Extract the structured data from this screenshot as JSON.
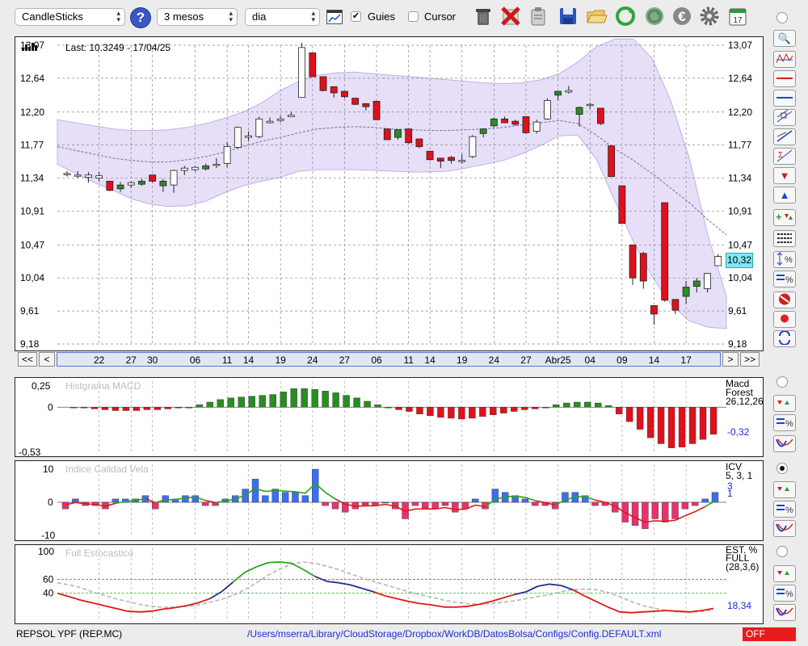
{
  "toolbar": {
    "chart_type": "CandleSticks",
    "period": "3 mesos",
    "interval": "dia",
    "guides_label": "Guies",
    "guides_checked": true,
    "cursor_label": "Cursor",
    "cursor_checked": false,
    "icons": [
      "trash-icon",
      "delete-icon",
      "clipboard-icon",
      "save-icon",
      "open-folder-icon",
      "refresh-icon",
      "reload-icon",
      "euro-icon",
      "gear-icon",
      "calendar-icon"
    ],
    "calendar_day": "17"
  },
  "status": {
    "ticker": "REPSOL YPF (REP.MC)",
    "path": "/Users/mserra/Library/CloudStorage/Dropbox/WorkDB/DatosBolsa/Configs/Config.DEFAULT.xml",
    "state": "OFF"
  },
  "nav": {
    "first": "<<",
    "prev": "<",
    "next": ">",
    "last": ">>"
  },
  "chart_data": [
    {
      "type": "candlestick",
      "title": "Last: 10.3249 - 17/04/25",
      "yticks": [
        "13,07",
        "12,64",
        "12,20",
        "11,77",
        "11,34",
        "10,91",
        "10,47",
        "10,04",
        "9,61",
        "9,18"
      ],
      "ylim": [
        9.18,
        13.07
      ],
      "last_value": "10,32",
      "date_labels": [
        "22",
        "27",
        "30",
        "06",
        "11",
        "14",
        "19",
        "24",
        "27",
        "06",
        "11",
        "14",
        "19",
        "24",
        "27",
        "Abr25",
        "04",
        "09",
        "14",
        "17"
      ],
      "candles": [
        {
          "o": 11.4,
          "h": 11.43,
          "l": 11.36,
          "c": 11.4
        },
        {
          "o": 11.38,
          "h": 11.43,
          "l": 11.34,
          "c": 11.38
        },
        {
          "o": 11.35,
          "h": 11.42,
          "l": 11.28,
          "c": 11.38
        },
        {
          "o": 11.34,
          "h": 11.42,
          "l": 11.3,
          "c": 11.37
        },
        {
          "o": 11.3,
          "h": 11.3,
          "l": 11.17,
          "c": 11.18
        },
        {
          "o": 11.2,
          "h": 11.29,
          "l": 11.16,
          "c": 11.25
        },
        {
          "o": 11.25,
          "h": 11.3,
          "l": 11.21,
          "c": 11.28
        },
        {
          "o": 11.26,
          "h": 11.33,
          "l": 11.24,
          "c": 11.3
        },
        {
          "o": 11.38,
          "h": 11.38,
          "l": 11.28,
          "c": 11.3
        },
        {
          "o": 11.24,
          "h": 11.33,
          "l": 11.16,
          "c": 11.3
        },
        {
          "o": 11.25,
          "h": 11.45,
          "l": 11.15,
          "c": 11.44
        },
        {
          "o": 11.44,
          "h": 11.5,
          "l": 11.38,
          "c": 11.47
        },
        {
          "o": 11.45,
          "h": 11.5,
          "l": 11.43,
          "c": 11.48
        },
        {
          "o": 11.46,
          "h": 11.53,
          "l": 11.44,
          "c": 11.5
        },
        {
          "o": 11.52,
          "h": 11.6,
          "l": 11.47,
          "c": 11.52
        },
        {
          "o": 11.53,
          "h": 11.81,
          "l": 11.48,
          "c": 11.75
        },
        {
          "o": 11.74,
          "h": 12.01,
          "l": 11.72,
          "c": 12.0
        },
        {
          "o": 11.87,
          "h": 11.95,
          "l": 11.82,
          "c": 11.89
        },
        {
          "o": 11.88,
          "h": 12.14,
          "l": 11.86,
          "c": 12.11
        },
        {
          "o": 12.06,
          "h": 12.13,
          "l": 12.05,
          "c": 12.08
        },
        {
          "o": 12.09,
          "h": 12.15,
          "l": 12.07,
          "c": 12.11
        },
        {
          "o": 12.14,
          "h": 12.2,
          "l": 12.14,
          "c": 12.16
        },
        {
          "o": 12.39,
          "h": 13.1,
          "l": 12.39,
          "c": 13.04
        },
        {
          "o": 12.97,
          "h": 12.97,
          "l": 12.66,
          "c": 12.66
        },
        {
          "o": 12.66,
          "h": 12.66,
          "l": 12.47,
          "c": 12.48
        },
        {
          "o": 12.53,
          "h": 12.53,
          "l": 12.39,
          "c": 12.45
        },
        {
          "o": 12.47,
          "h": 12.47,
          "l": 12.38,
          "c": 12.4
        },
        {
          "o": 12.38,
          "h": 12.38,
          "l": 12.29,
          "c": 12.3
        },
        {
          "o": 12.31,
          "h": 12.31,
          "l": 12.22,
          "c": 12.27
        },
        {
          "o": 12.34,
          "h": 12.34,
          "l": 12.1,
          "c": 12.1
        },
        {
          "o": 11.98,
          "h": 11.98,
          "l": 11.84,
          "c": 11.84
        },
        {
          "o": 11.87,
          "h": 11.97,
          "l": 11.84,
          "c": 11.97
        },
        {
          "o": 11.98,
          "h": 11.98,
          "l": 11.79,
          "c": 11.8
        },
        {
          "o": 11.85,
          "h": 11.85,
          "l": 11.73,
          "c": 11.75
        },
        {
          "o": 11.69,
          "h": 11.69,
          "l": 11.57,
          "c": 11.58
        },
        {
          "o": 11.6,
          "h": 11.6,
          "l": 11.47,
          "c": 11.56
        },
        {
          "o": 11.61,
          "h": 11.63,
          "l": 11.53,
          "c": 11.57
        },
        {
          "o": 11.57,
          "h": 11.65,
          "l": 11.53,
          "c": 11.57
        },
        {
          "o": 11.62,
          "h": 11.9,
          "l": 11.6,
          "c": 11.88
        },
        {
          "o": 11.92,
          "h": 11.99,
          "l": 11.87,
          "c": 11.98
        },
        {
          "o": 12.02,
          "h": 12.13,
          "l": 12.0,
          "c": 12.11
        },
        {
          "o": 12.11,
          "h": 12.14,
          "l": 12.06,
          "c": 12.06
        },
        {
          "o": 12.08,
          "h": 12.1,
          "l": 12.02,
          "c": 12.04
        },
        {
          "o": 12.14,
          "h": 12.14,
          "l": 11.92,
          "c": 11.93
        },
        {
          "o": 11.95,
          "h": 12.1,
          "l": 11.92,
          "c": 12.07
        },
        {
          "o": 12.11,
          "h": 12.38,
          "l": 12.1,
          "c": 12.35
        },
        {
          "o": 12.42,
          "h": 12.47,
          "l": 12.35,
          "c": 12.47
        },
        {
          "o": 12.46,
          "h": 12.54,
          "l": 12.44,
          "c": 12.48
        },
        {
          "o": 12.17,
          "h": 12.27,
          "l": 12.01,
          "c": 12.26
        },
        {
          "o": 12.3,
          "h": 12.32,
          "l": 12.24,
          "c": 12.3
        },
        {
          "o": 12.25,
          "h": 12.25,
          "l": 12.03,
          "c": 12.05
        },
        {
          "o": 11.76,
          "h": 11.76,
          "l": 11.36,
          "c": 11.36
        },
        {
          "o": 11.24,
          "h": 11.24,
          "l": 10.75,
          "c": 10.75
        },
        {
          "o": 10.47,
          "h": 10.47,
          "l": 9.95,
          "c": 10.04
        },
        {
          "o": 10.36,
          "h": 10.38,
          "l": 9.9,
          "c": 10.0
        },
        {
          "o": 9.68,
          "h": 9.68,
          "l": 9.43,
          "c": 9.57
        },
        {
          "o": 11.02,
          "h": 11.02,
          "l": 9.73,
          "c": 9.75
        },
        {
          "o": 9.76,
          "h": 9.76,
          "l": 9.57,
          "c": 9.62
        },
        {
          "o": 9.8,
          "h": 10.0,
          "l": 9.7,
          "c": 9.92
        },
        {
          "o": 9.93,
          "h": 10.04,
          "l": 9.85,
          "c": 10.0
        },
        {
          "o": 9.9,
          "h": 10.1,
          "l": 9.85,
          "c": 10.1
        },
        {
          "o": 10.2,
          "h": 10.35,
          "l": 10.2,
          "c": 10.32
        }
      ],
      "bollinger_upper": [
        12.1,
        12.06,
        12.02,
        11.98,
        11.96,
        11.96,
        11.97,
        12.0,
        12.05,
        12.12,
        12.2,
        12.32,
        12.48,
        12.6,
        12.68,
        12.71,
        12.72,
        12.7,
        12.68,
        12.66,
        12.64,
        12.62,
        12.6,
        12.58,
        12.57,
        12.58,
        12.62,
        12.7,
        12.85,
        13.05,
        13.15,
        13.15,
        12.9,
        12.35,
        11.6,
        10.6,
        9.8
      ],
      "bollinger_lower": [
        11.52,
        11.4,
        11.28,
        11.18,
        11.07,
        11.0,
        10.97,
        10.98,
        11.04,
        11.15,
        11.24,
        11.3,
        11.35,
        11.43,
        11.45,
        11.45,
        11.45,
        11.44,
        11.43,
        11.42,
        11.42,
        11.43,
        11.47,
        11.52,
        11.57,
        11.66,
        11.76,
        11.89,
        11.9,
        11.59,
        11.04,
        10.51,
        10.06,
        9.7,
        9.48,
        9.4,
        9.38
      ],
      "bollinger_mid": [
        11.75,
        11.7,
        11.65,
        11.6,
        11.57,
        11.55,
        11.55,
        11.58,
        11.62,
        11.68,
        11.75,
        11.82,
        11.87,
        11.93,
        11.98,
        12.0,
        12.01,
        12.0,
        11.98,
        11.97,
        11.96,
        11.96,
        11.97,
        11.98,
        12.0,
        12.03,
        12.06,
        12.09,
        12.05,
        11.9,
        11.72,
        11.57,
        11.4,
        11.21,
        11.02,
        10.8,
        10.6
      ]
    },
    {
      "type": "bar",
      "title": "Histgrama MACD",
      "series_label": "Macd Forest",
      "params": "26,12,26",
      "last_value": "-0,32",
      "yticks": [
        "0,25",
        "0",
        "-0,53"
      ],
      "ylim": [
        -0.53,
        0.25
      ],
      "values": [
        0,
        -0.01,
        -0.02,
        -0.03,
        -0.04,
        -0.04,
        -0.04,
        -0.03,
        -0.03,
        -0.02,
        -0.01,
        0,
        0.03,
        0.06,
        0.09,
        0.11,
        0.12,
        0.13,
        0.14,
        0.15,
        0.18,
        0.22,
        0.22,
        0.21,
        0.19,
        0.17,
        0.14,
        0.11,
        0.07,
        0.03,
        0,
        -0.03,
        -0.05,
        -0.08,
        -0.1,
        -0.12,
        -0.13,
        -0.14,
        -0.13,
        -0.11,
        -0.09,
        -0.07,
        -0.05,
        -0.03,
        -0.02,
        0,
        0.03,
        0.05,
        0.06,
        0.06,
        0.05,
        0.02,
        -0.08,
        -0.17,
        -0.26,
        -0.36,
        -0.43,
        -0.48,
        -0.47,
        -0.43,
        -0.38,
        -0.32
      ]
    },
    {
      "type": "bar+line",
      "title": "Indice Calidad Vela",
      "series_label": "ICV",
      "params": "5, 3, 1",
      "last_values": [
        "3",
        "1"
      ],
      "yticks": [
        "10",
        "0",
        "-10"
      ],
      "ylim": [
        -10,
        10
      ],
      "values": [
        -2,
        1,
        -1,
        -1,
        -2,
        1,
        1,
        1,
        2,
        -2,
        2,
        1,
        2,
        2,
        -1,
        -1,
        1,
        2,
        4,
        7,
        2,
        4,
        3,
        3,
        2,
        10,
        -1,
        -2,
        -3,
        -2,
        -1,
        -1,
        0,
        -2,
        -5,
        -1,
        -2,
        -2,
        -1,
        -3,
        -2,
        1,
        -2,
        4,
        3,
        2,
        1,
        -1,
        -1,
        -2,
        3,
        3,
        2,
        -1,
        -1,
        -3,
        -6,
        -7,
        -8,
        -5,
        -6,
        -5,
        -2,
        -1,
        1,
        3
      ]
    },
    {
      "type": "line",
      "title": "Full Estocastico",
      "series_label": "EST. % FULL",
      "params": "(28,3,6)",
      "last_value": "18,34",
      "yticks": [
        "100",
        "60",
        "40"
      ],
      "ylim": [
        0,
        100
      ],
      "reference_levels": [
        60,
        40
      ],
      "k_line": [
        40,
        35,
        30,
        26,
        22,
        18,
        14,
        13,
        14,
        17,
        19,
        22,
        26,
        32,
        42,
        56,
        70,
        78,
        84,
        85,
        83,
        74,
        64,
        57,
        55,
        52,
        47,
        42,
        36,
        32,
        28,
        25,
        23,
        20,
        20,
        21,
        24,
        28,
        33,
        38,
        42,
        50,
        53,
        51,
        45,
        36,
        28,
        20,
        13,
        12,
        13,
        14,
        15,
        14,
        13,
        15,
        18
      ],
      "d_line": [
        55,
        52,
        48,
        42,
        37,
        32,
        28,
        24,
        21,
        20,
        20,
        21,
        23,
        27,
        31,
        37,
        45,
        55,
        66,
        75,
        82,
        85,
        83,
        79,
        74,
        68,
        62,
        57,
        52,
        47,
        42,
        38,
        34,
        30,
        27,
        25,
        24,
        25,
        27,
        29,
        32,
        35,
        38,
        42,
        45,
        46,
        45,
        41,
        35,
        28,
        22,
        18,
        15,
        13,
        13,
        14,
        16
      ]
    }
  ]
}
